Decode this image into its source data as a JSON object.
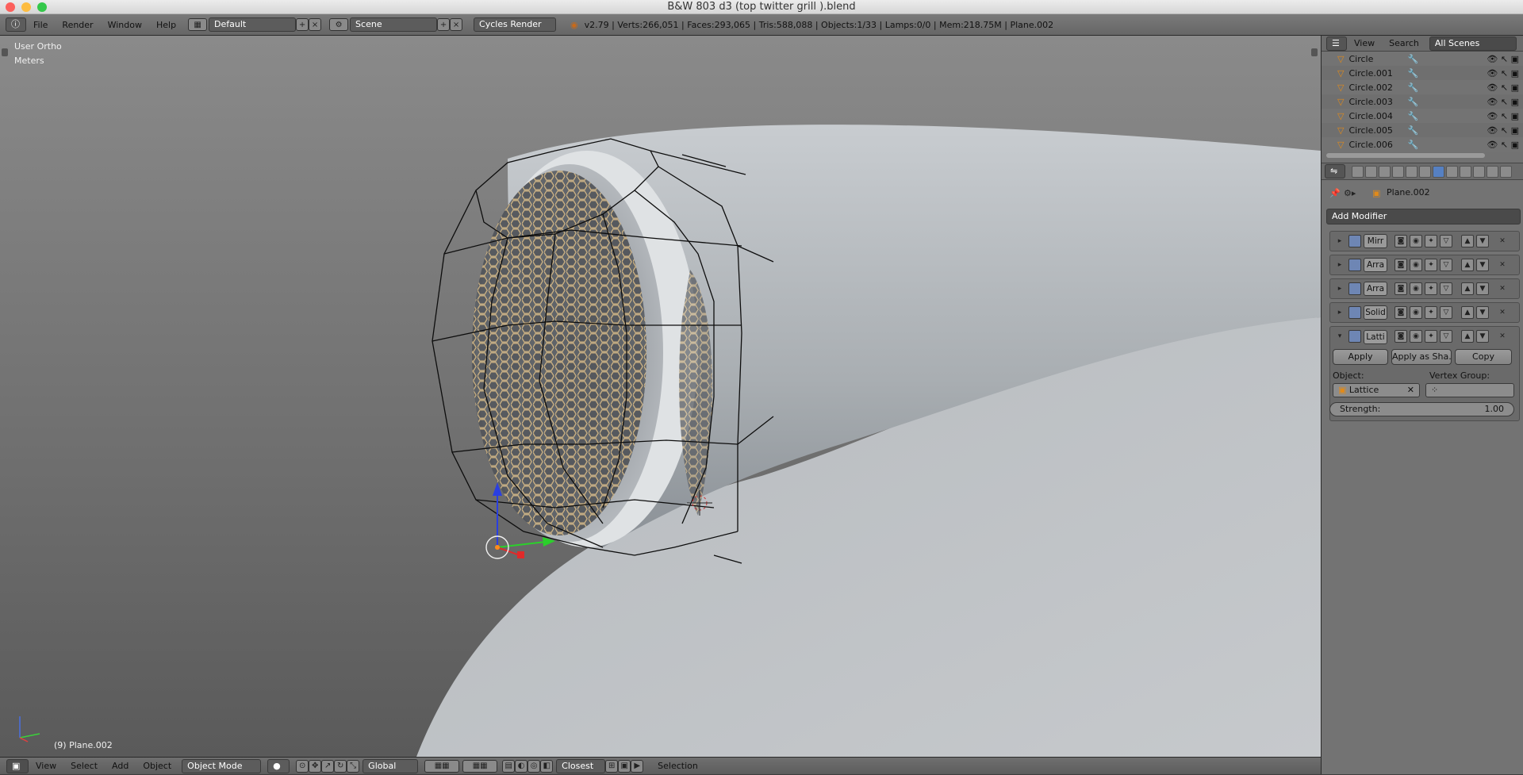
{
  "window": {
    "title": "B&W 803 d3 (top twitter grill ).blend"
  },
  "top_menu": [
    "File",
    "Render",
    "Window",
    "Help"
  ],
  "layout": {
    "value": "Default"
  },
  "scene": {
    "value": "Scene"
  },
  "render_engine": {
    "value": "Cycles Render"
  },
  "stats": "v2.79 | Verts:266,051 | Faces:293,065 | Tris:588,088 | Objects:1/33 | Lamps:0/0 | Mem:218.75M | Plane.002",
  "viewport": {
    "view_name": "User Ortho",
    "units": "Meters",
    "active_object": "(9) Plane.002"
  },
  "bottom_bar": {
    "menus": [
      "View",
      "Select",
      "Add",
      "Object"
    ],
    "mode": "Object Mode",
    "orientation": "Global",
    "snap": "Closest",
    "status": "Selection"
  },
  "outliner": {
    "view_label": "View",
    "search_label": "Search",
    "scene_filter": "All Scenes",
    "items": [
      {
        "name": "Circle"
      },
      {
        "name": "Circle.001"
      },
      {
        "name": "Circle.002"
      },
      {
        "name": "Circle.003"
      },
      {
        "name": "Circle.004"
      },
      {
        "name": "Circle.005"
      },
      {
        "name": "Circle.006"
      }
    ]
  },
  "properties": {
    "object_name": "Plane.002",
    "add_modifier": "Add Modifier",
    "modifiers": [
      {
        "name": "Mirr",
        "expanded": false
      },
      {
        "name": "Arra",
        "expanded": false
      },
      {
        "name": "Arra",
        "expanded": false
      },
      {
        "name": "Solid",
        "expanded": false
      },
      {
        "name": "Latti",
        "expanded": true
      }
    ],
    "lattice": {
      "apply": "Apply",
      "apply_shape": "Apply as Sha...",
      "copy": "Copy",
      "object_label": "Object:",
      "object_value": "Lattice",
      "vertex_group_label": "Vertex Group:",
      "strength_label": "Strength:",
      "strength_value": "1.00"
    }
  },
  "colors": {
    "accent": "#5680c2",
    "mesh_grey": "#cfd3d6",
    "wire_black": "#111111"
  }
}
